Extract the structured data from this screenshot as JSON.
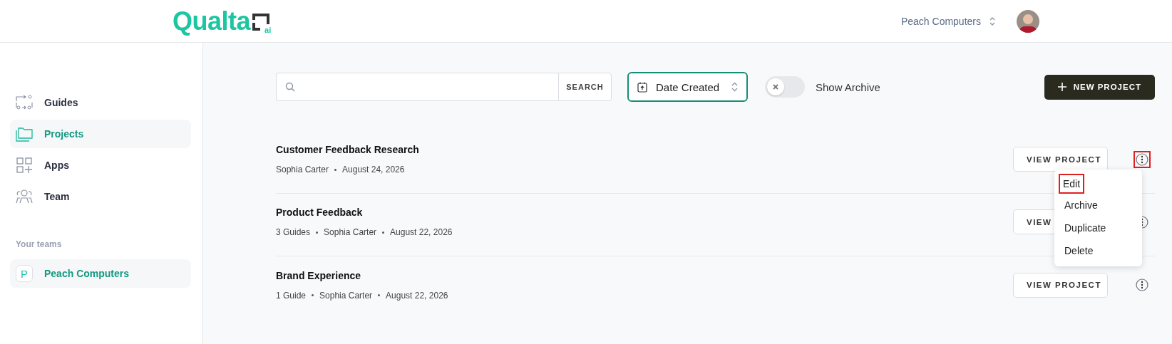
{
  "header": {
    "logo": {
      "text": "Qualta",
      "suffix": "ai"
    },
    "team_switcher": "Peach Computers"
  },
  "sidebar": {
    "items": [
      {
        "label": "Guides",
        "selected": false
      },
      {
        "label": "Projects",
        "selected": true
      },
      {
        "label": "Apps",
        "selected": false
      },
      {
        "label": "Team",
        "selected": false
      }
    ],
    "teams_heading": "Your teams",
    "teams": [
      {
        "initial": "P",
        "name": "Peach Computers",
        "selected": true
      }
    ]
  },
  "toolbar": {
    "search": {
      "button": "SEARCH"
    },
    "sort": {
      "label": "Date Created"
    },
    "archive_toggle": {
      "label": "Show Archive",
      "on": false
    },
    "new_button": "NEW PROJECT"
  },
  "projects": [
    {
      "title": "Customer Feedback Research",
      "meta": [
        "Sophia Carter",
        "August 24, 2026"
      ],
      "button": "VIEW PROJECT",
      "menu_highlighted": true,
      "menu": [
        {
          "label": "Edit",
          "highlighted": true
        },
        {
          "label": "Archive",
          "highlighted": false
        },
        {
          "label": "Duplicate",
          "highlighted": false
        },
        {
          "label": "Delete",
          "highlighted": false
        }
      ]
    },
    {
      "title": "Product Feedback",
      "meta": [
        "3 Guides",
        "Sophia Carter",
        "August 22, 2026"
      ],
      "button": "VIEW",
      "menu_highlighted": false
    },
    {
      "title": "Brand Experience",
      "meta": [
        "1 Guide",
        "Sophia Carter",
        "August 22, 2026"
      ],
      "button": "VIEW PROJECT",
      "menu_highlighted": false
    }
  ]
}
